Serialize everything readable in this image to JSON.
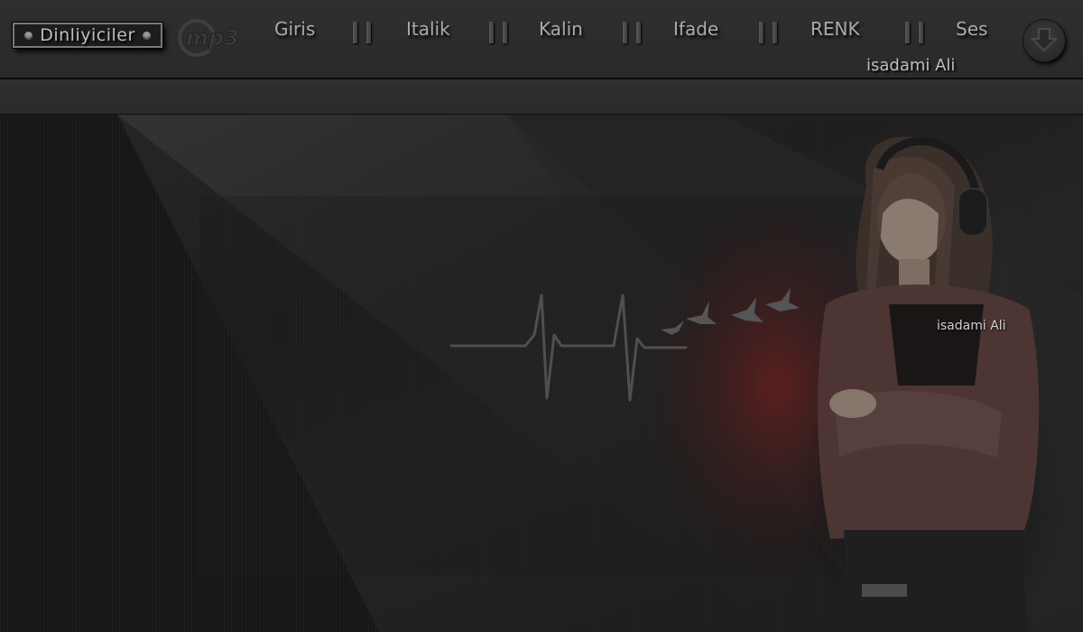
{
  "toolbar": {
    "listeners_label": "Dinliyiciler",
    "logo_text": "mp3",
    "menu": [
      {
        "label": "Giris"
      },
      {
        "label": "Italik"
      },
      {
        "label": "Kalin"
      },
      {
        "label": "Ifade"
      },
      {
        "label": "RENK"
      },
      {
        "label": "Ses"
      }
    ],
    "author": "isadami Ali"
  },
  "scene": {
    "author_label": "isadami Ali",
    "accent_color": "#5a1c1c"
  },
  "icons": {
    "down": "download-arrow-icon",
    "heartbeat": "heartbeat-line-icon",
    "birds": "bird-icon"
  }
}
